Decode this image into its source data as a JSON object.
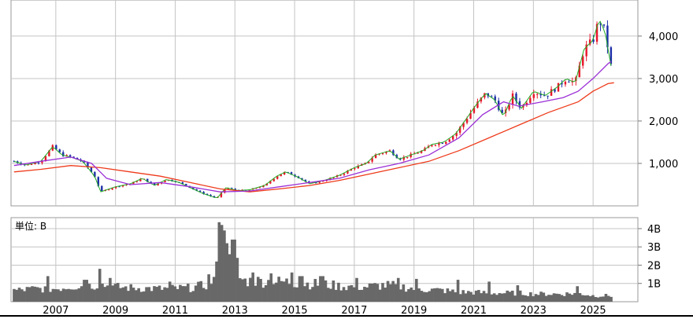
{
  "chart_data": [
    {
      "type": "candlestick",
      "title": "",
      "x_ticks": [
        "2007",
        "2009",
        "2011",
        "2013",
        "2015",
        "2017",
        "2019",
        "2021",
        "2023",
        "2025"
      ],
      "y_ticks": [
        "1,000",
        "2,000",
        "3,000",
        "4,000"
      ],
      "x_range": [
        2006.0,
        2027.0
      ],
      "ylim": [
        0,
        4850
      ],
      "grid": true,
      "colors": {
        "up": "#e8162a",
        "down": "#1d2fa8",
        "ma_short": "#22aa22",
        "ma_mid": "#9b2fd6",
        "ma_long": "#ee3a1a"
      },
      "series": [
        {
          "kind": "close",
          "x": [
            2006.1,
            2006.5,
            2007.0,
            2007.4,
            2007.7,
            2008.0,
            2008.4,
            2008.8,
            2009.0,
            2009.5,
            2010.0,
            2010.4,
            2010.8,
            2011.2,
            2011.6,
            2012.0,
            2012.4,
            2012.9,
            2013.2,
            2013.6,
            2014.0,
            2014.5,
            2014.9,
            2015.2,
            2015.6,
            2016.0,
            2016.5,
            2017.0,
            2017.5,
            2017.9,
            2018.2,
            2018.7,
            2019.0,
            2019.4,
            2019.8,
            2020.1,
            2020.5,
            2020.9,
            2021.2,
            2021.6,
            2021.9,
            2022.2,
            2022.5,
            2022.8,
            2023.1,
            2023.5,
            2023.9,
            2024.3,
            2024.6,
            2024.9,
            2025.2,
            2025.5,
            2025.7,
            2025.9,
            2026.1
          ],
          "y": [
            1050,
            960,
            1050,
            1400,
            1200,
            1150,
            1050,
            700,
            330,
            450,
            520,
            650,
            480,
            620,
            560,
            430,
            300,
            180,
            430,
            360,
            380,
            480,
            700,
            800,
            680,
            520,
            600,
            720,
            900,
            1000,
            1200,
            1300,
            1100,
            1200,
            1300,
            1450,
            1500,
            1700,
            2000,
            2400,
            2650,
            2500,
            2100,
            2600,
            2300,
            2700,
            2600,
            2800,
            3000,
            2900,
            3700,
            3900,
            4400,
            4100,
            3300
          ]
        },
        {
          "kind": "ma",
          "name": "",
          "color": "#9b2fd6",
          "x": [
            2006.1,
            2007.0,
            2008.0,
            2008.7,
            2009.2,
            2010.0,
            2011.0,
            2012.0,
            2013.0,
            2014.0,
            2015.0,
            2016.0,
            2017.0,
            2018.0,
            2019.0,
            2020.0,
            2021.0,
            2021.8,
            2022.5,
            2023.0,
            2023.8,
            2024.5,
            2025.0,
            2025.5,
            2026.0,
            2026.1
          ],
          "y": [
            950,
            1050,
            1150,
            1000,
            650,
            500,
            550,
            450,
            330,
            350,
            450,
            550,
            650,
            850,
            1000,
            1200,
            1600,
            2150,
            2450,
            2350,
            2450,
            2550,
            2700,
            3000,
            3350,
            3400
          ]
        },
        {
          "kind": "ma",
          "name": "",
          "color": "#ee3a1a",
          "x": [
            2006.1,
            2007.0,
            2008.0,
            2009.0,
            2010.0,
            2011.0,
            2012.0,
            2013.0,
            2014.0,
            2015.0,
            2016.0,
            2017.0,
            2018.0,
            2019.0,
            2020.0,
            2021.0,
            2022.0,
            2023.0,
            2024.0,
            2025.0,
            2025.5,
            2026.0,
            2026.2
          ],
          "y": [
            800,
            860,
            950,
            900,
            800,
            700,
            550,
            400,
            330,
            400,
            480,
            600,
            750,
            900,
            1050,
            1300,
            1600,
            1900,
            2200,
            2450,
            2700,
            2880,
            2900
          ]
        }
      ]
    },
    {
      "type": "bar",
      "unit_label": "単位: B",
      "x_ticks": [
        "2007",
        "2009",
        "2011",
        "2013",
        "2015",
        "2017",
        "2019",
        "2021",
        "2023",
        "2025"
      ],
      "y_ticks": [
        "1B",
        "2B",
        "3B",
        "4B"
      ],
      "ylim": [
        0,
        4.6
      ],
      "grid": true,
      "color": "#686868",
      "volume_profile": {
        "x": [
          2006.1,
          2006.8,
          2007.5,
          2008.0,
          2008.5,
          2009.0,
          2009.5,
          2010.0,
          2011.0,
          2012.0,
          2012.5,
          2012.8,
          2013.0,
          2013.2,
          2013.5,
          2013.8,
          2014.2,
          2014.8,
          2015.2,
          2015.8,
          2016.5,
          2017.0,
          2017.8,
          2018.5,
          2019.0,
          2019.5,
          2020.0,
          2020.5,
          2021.0,
          2021.5,
          2022.0,
          2022.5,
          2023.0,
          2023.5,
          2024.0,
          2024.5,
          2025.0,
          2025.5,
          2026.1
        ],
        "y": [
          0.65,
          0.75,
          0.75,
          0.9,
          0.9,
          1.0,
          0.85,
          0.8,
          0.75,
          0.8,
          0.95,
          1.3,
          1.9,
          2.8,
          1.6,
          1.2,
          1.2,
          1.15,
          1.15,
          1.05,
          1.0,
          0.9,
          0.85,
          0.95,
          0.9,
          0.75,
          0.7,
          0.65,
          0.55,
          0.55,
          0.5,
          0.5,
          0.5,
          0.45,
          0.45,
          0.45,
          0.5,
          0.35,
          0.35
        ]
      },
      "volume_spikes": [
        {
          "x": 2007.2,
          "y": 1.4
        },
        {
          "x": 2008.5,
          "y": 1.2
        },
        {
          "x": 2009.0,
          "y": 1.8
        },
        {
          "x": 2009.3,
          "y": 1.3
        },
        {
          "x": 2011.3,
          "y": 1.1
        },
        {
          "x": 2012.6,
          "y": 1.5
        },
        {
          "x": 2012.85,
          "y": 2.2
        },
        {
          "x": 2013.0,
          "y": 4.35
        },
        {
          "x": 2013.08,
          "y": 4.2
        },
        {
          "x": 2013.16,
          "y": 3.9
        },
        {
          "x": 2013.25,
          "y": 3.2
        },
        {
          "x": 2013.35,
          "y": 2.6
        },
        {
          "x": 2013.45,
          "y": 3.4
        },
        {
          "x": 2013.55,
          "y": 2.4
        },
        {
          "x": 2014.1,
          "y": 1.6
        },
        {
          "x": 2014.7,
          "y": 1.55
        },
        {
          "x": 2015.4,
          "y": 1.6
        },
        {
          "x": 2015.7,
          "y": 1.4
        },
        {
          "x": 2016.4,
          "y": 1.4
        },
        {
          "x": 2017.6,
          "y": 1.3
        },
        {
          "x": 2019.0,
          "y": 1.3
        },
        {
          "x": 2019.6,
          "y": 1.25
        },
        {
          "x": 2021.0,
          "y": 1.2
        },
        {
          "x": 2022.0,
          "y": 1.1
        },
        {
          "x": 2023.0,
          "y": 0.9
        },
        {
          "x": 2025.0,
          "y": 0.85
        }
      ]
    }
  ]
}
